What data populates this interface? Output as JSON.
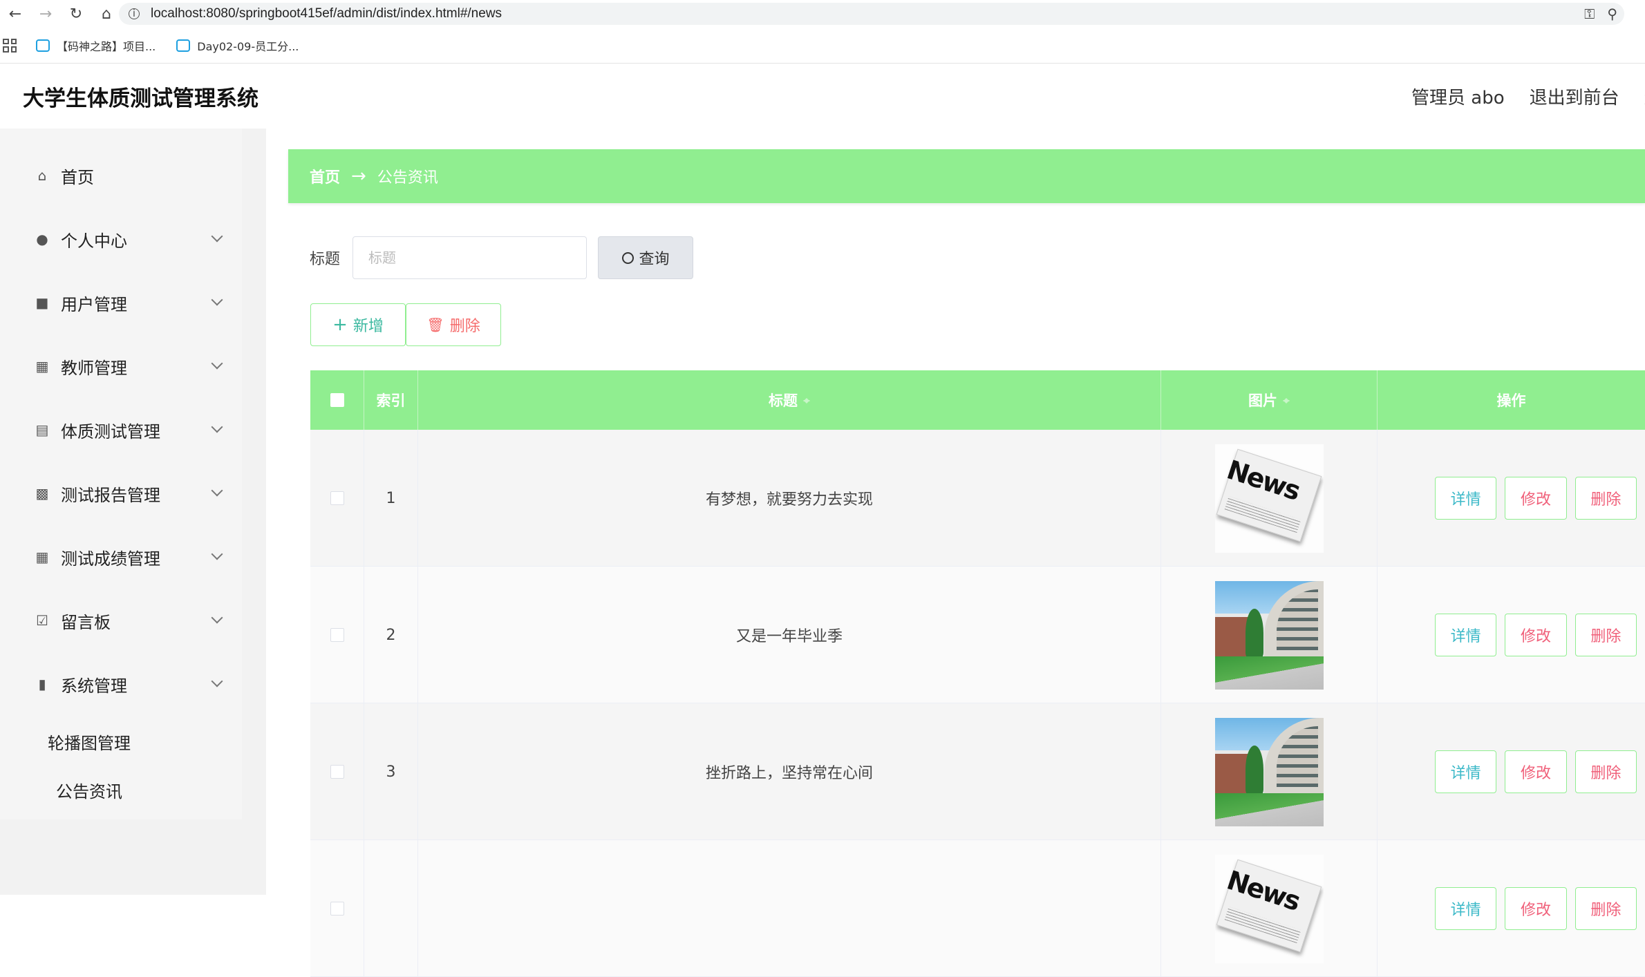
{
  "browser": {
    "url": "localhost:8080/springboot415ef/admin/dist/index.html#/news",
    "bookmarks": [
      {
        "label": "【码神之路】项目..."
      },
      {
        "label": "Day02-09-员工分..."
      }
    ]
  },
  "header": {
    "title": "大学生体质测试管理系统",
    "user": "管理员 abo",
    "to_front": "退出到前台",
    "logout": "退"
  },
  "sidebar": {
    "items": [
      {
        "label": "首页",
        "icon": "home-icon"
      },
      {
        "label": "个人中心",
        "icon": "user-icon"
      },
      {
        "label": "用户管理",
        "icon": "briefcase-icon"
      },
      {
        "label": "教师管理",
        "icon": "grid-icon"
      },
      {
        "label": "体质测试管理",
        "icon": "chart-icon"
      },
      {
        "label": "测试报告管理",
        "icon": "message-icon"
      },
      {
        "label": "测试成绩管理",
        "icon": "grid-icon"
      },
      {
        "label": "留言板",
        "icon": "clipboard-icon"
      },
      {
        "label": "系统管理",
        "icon": "pin-icon"
      }
    ],
    "sub_items": [
      {
        "label": "轮播图管理"
      },
      {
        "label": "公告资讯"
      }
    ]
  },
  "breadcrumb": {
    "home": "首页",
    "arrow": "→",
    "current": "公告资讯"
  },
  "search": {
    "label": "标题",
    "placeholder": "标题",
    "value": "",
    "button": "查询"
  },
  "actions": {
    "add": "新增",
    "delete": "删除"
  },
  "table": {
    "headers": {
      "index": "索引",
      "title": "标题",
      "image": "图片",
      "ops": "操作"
    },
    "rows": [
      {
        "index": "1",
        "title": "有梦想，就要努力去实现",
        "image": "news-image"
      },
      {
        "index": "2",
        "title": "又是一年毕业季",
        "image": "campus-image"
      },
      {
        "index": "3",
        "title": "挫折路上，坚持常在心间",
        "image": "campus-image"
      },
      {
        "index": "",
        "title": "",
        "image": "news-image"
      }
    ],
    "row_buttons": {
      "detail": "详情",
      "edit": "修改",
      "delete": "删除"
    },
    "news_word": "News"
  },
  "colors": {
    "accent": "#90ee90",
    "detail": "#3cb9c8",
    "danger": "#f0607a"
  }
}
